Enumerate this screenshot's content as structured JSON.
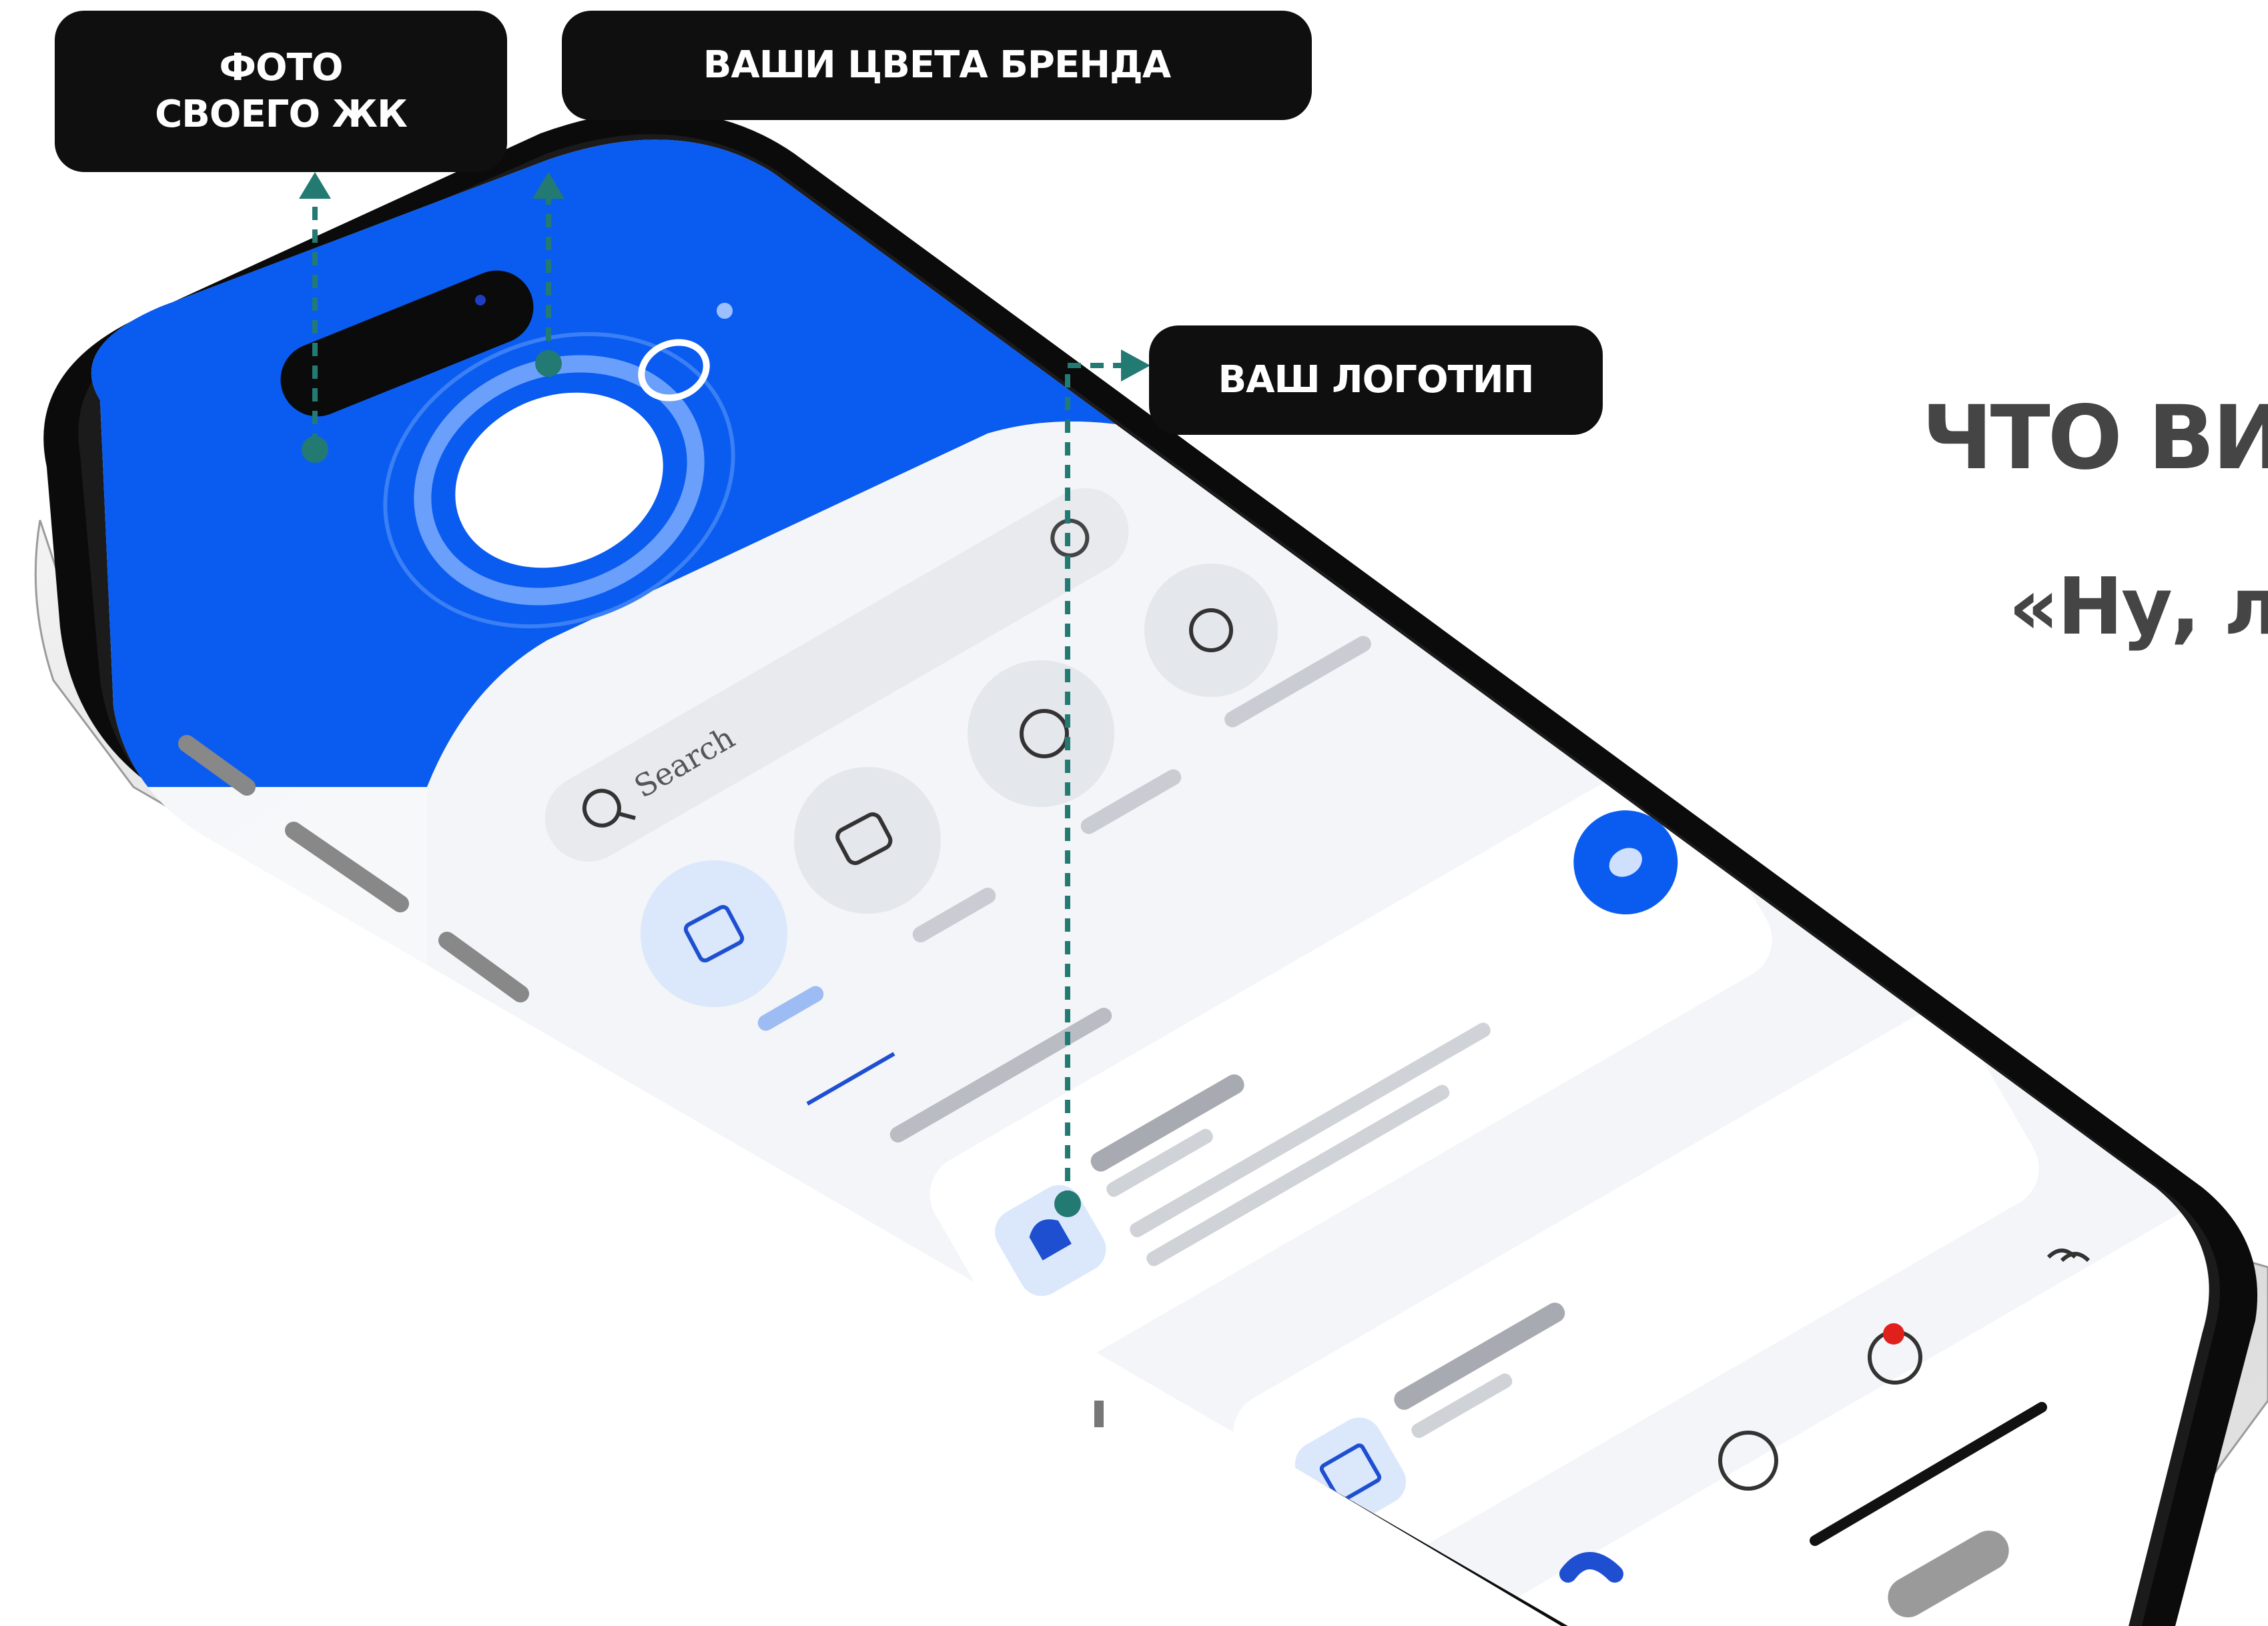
{
  "callouts": {
    "photo_line1": "ФОТО",
    "photo_line2": "СВОЕГО ЖК",
    "brand_colors": "ВАШИ ЦВЕТА БРЕНДА",
    "logo": "ВАШ ЛОГОТИП"
  },
  "headline": {
    "title": "ЧТО ВИ",
    "subtitle": "«Ну, л"
  },
  "phone_screen": {
    "search_text": "Search"
  },
  "colors": {
    "brand_blue": "#0a5cf0",
    "callout_bg": "#0f0f0f",
    "leader_teal": "#237a72",
    "headline_gray": "#454545"
  }
}
